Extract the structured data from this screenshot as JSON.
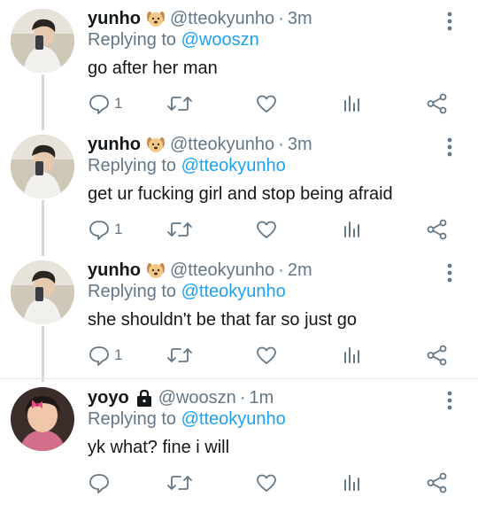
{
  "tweets": [
    {
      "display_name": "yunho",
      "name_emoji": "dog-face-emoji",
      "handle": "@tteokyunho",
      "separator": "·",
      "time": "3m",
      "replying_prefix": "Replying to",
      "replying_to": "@wooszn",
      "text": "go after her man",
      "reply_count": "1"
    },
    {
      "display_name": "yunho",
      "name_emoji": "dog-face-emoji",
      "handle": "@tteokyunho",
      "separator": "·",
      "time": "3m",
      "replying_prefix": "Replying to",
      "replying_to": "@tteokyunho",
      "text": "get ur fucking girl and stop being afraid",
      "reply_count": "1"
    },
    {
      "display_name": "yunho",
      "name_emoji": "dog-face-emoji",
      "handle": "@tteokyunho",
      "separator": "·",
      "time": "2m",
      "replying_prefix": "Replying to",
      "replying_to": "@tteokyunho",
      "text": "she shouldn't be that far so just go",
      "reply_count": "1"
    },
    {
      "display_name": "yoyo",
      "name_emoji": "lock-icon",
      "handle": "@wooszn",
      "separator": "·",
      "time": "1m",
      "replying_prefix": "Replying to",
      "replying_to": "@tteokyunho",
      "text": "yk what? fine i will",
      "reply_count": ""
    }
  ],
  "colors": {
    "accent": "#1da1f2",
    "secondary_text": "#657786",
    "icon": "#657786",
    "thread_line": "#cfd9de"
  },
  "icons": {
    "reply": "speech-bubble-icon",
    "retweet": "retweet-icon",
    "like": "heart-icon",
    "stats": "bar-chart-icon",
    "share": "share-icon",
    "more": "vertical-ellipsis-icon"
  }
}
